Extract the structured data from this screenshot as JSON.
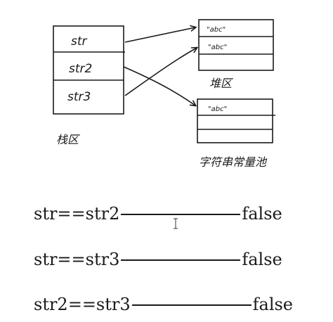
{
  "diagram": {
    "stack": {
      "cells": [
        "str",
        "str2",
        "str3"
      ],
      "label": "栈区"
    },
    "heap": {
      "cells": [
        "\"abc\"",
        "\"abc\""
      ],
      "label": "堆区"
    },
    "string_pool": {
      "cells": [
        "\"abc\""
      ],
      "label": "字符串常量池"
    }
  },
  "comparisons": [
    {
      "expr": "str==str2",
      "result": "false"
    },
    {
      "expr": "str==str3",
      "result": "false"
    },
    {
      "expr": "str2==str3",
      "result": "false"
    }
  ]
}
